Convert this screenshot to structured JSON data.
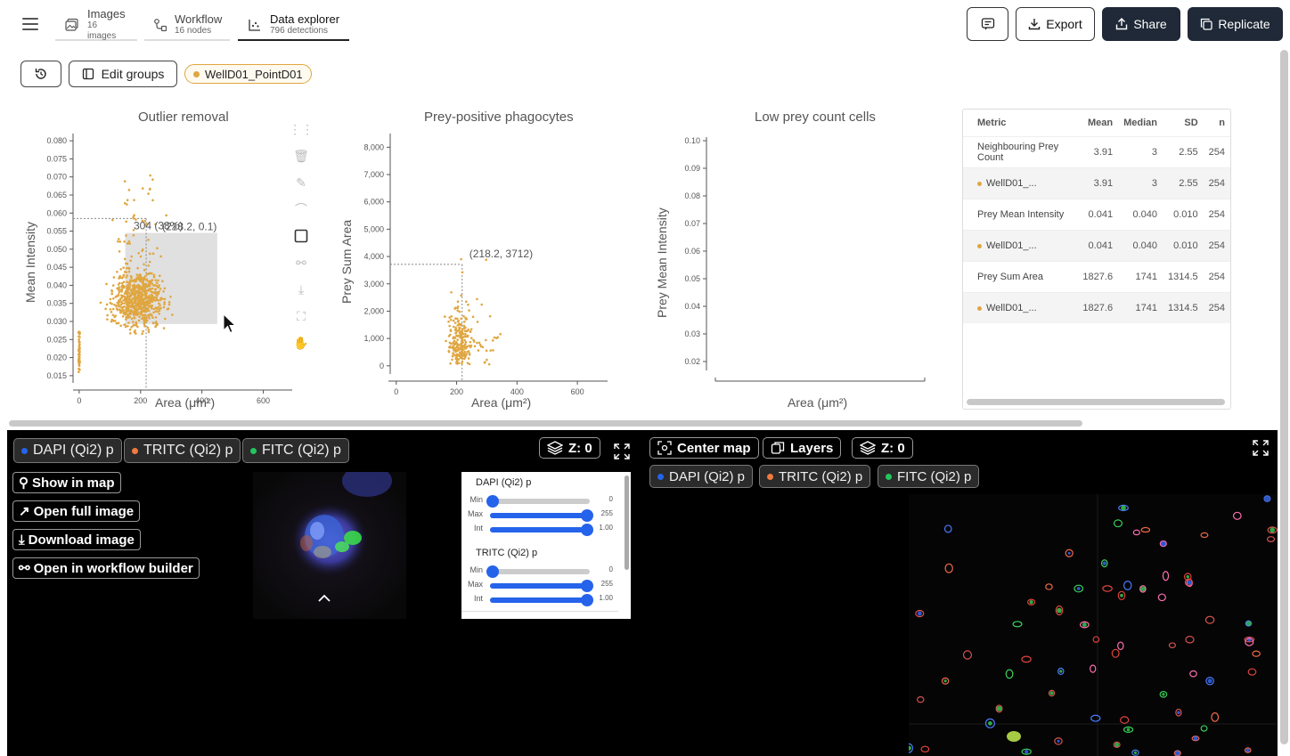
{
  "tabs": [
    {
      "label": "Images",
      "sub": "16 images",
      "icon": "images-icon"
    },
    {
      "label": "Workflow",
      "sub": "16 nodes",
      "icon": "workflow-icon"
    },
    {
      "label": "Data explorer",
      "sub": "796 detections",
      "icon": "scatter-icon"
    }
  ],
  "header": {
    "export_label": "Export",
    "share_label": "Share",
    "replicate_label": "Replicate"
  },
  "toolbar": {
    "edit_groups_label": "Edit groups",
    "well_chip_label": "WellD01_PointD01"
  },
  "colors": {
    "accent": "#1f2937",
    "point": "#e0a640",
    "dapi": "#2563eb",
    "tritc": "#f07b3f",
    "fitc": "#22c55e"
  },
  "chart_data": [
    {
      "type": "scatter",
      "title": "Outlier removal",
      "xlabel": "Area (μm²)",
      "ylabel": "Mean Intensity",
      "xlim": [
        -20,
        700
      ],
      "ylim": [
        0.013,
        0.082
      ],
      "xticks": [
        "0",
        "200",
        "400",
        "600"
      ],
      "yticks": [
        "0.015",
        "0.020",
        "0.025",
        "0.030",
        "0.035",
        "0.040",
        "0.045",
        "0.050",
        "0.055",
        "0.060",
        "0.065",
        "0.070",
        "0.075",
        "0.080"
      ],
      "series": [
        {
          "n": 796
        }
      ],
      "selection_label": "304 (38%)",
      "crosshair_label": "(218.2, 0.1)"
    },
    {
      "type": "scatter",
      "title": "Prey-positive phagocytes",
      "xlabel": "Area (μm²)",
      "ylabel": "Prey Sum Area",
      "xlim": [
        -20,
        700
      ],
      "ylim": [
        -300,
        8500
      ],
      "xticks": [
        "0",
        "200",
        "400",
        "600"
      ],
      "yticks": [
        "0",
        "1,000",
        "2,000",
        "3,000",
        "4,000",
        "5,000",
        "6,000",
        "7,000",
        "8,000"
      ],
      "series": [
        {
          "n": 254
        }
      ],
      "crosshair_label": "(218.2, 3712)"
    },
    {
      "type": "scatter",
      "title": "Low prey count cells",
      "xlabel": "Area (μm²)",
      "ylabel": "Prey Mean Intensity",
      "yticks": [
        "0.02",
        "0.03",
        "0.04",
        "0.05",
        "0.06",
        "0.07",
        "0.08",
        "0.09",
        "0.10"
      ],
      "series": []
    },
    {
      "type": "table",
      "columns": [
        "Metric",
        "Mean",
        "Median",
        "SD",
        "n"
      ],
      "rows": [
        {
          "metric": "Neighbouring Prey Count",
          "mean": "3.91",
          "median": "3",
          "sd": "2.55",
          "n": "254",
          "sub": false
        },
        {
          "metric": "WellD01_...",
          "mean": "3.91",
          "median": "3",
          "sd": "2.55",
          "n": "254",
          "sub": true
        },
        {
          "metric": "Prey Mean Intensity",
          "mean": "0.041",
          "median": "0.040",
          "sd": "0.010",
          "n": "254",
          "sub": false
        },
        {
          "metric": "WellD01_...",
          "mean": "0.041",
          "median": "0.040",
          "sd": "0.010",
          "n": "254",
          "sub": true
        },
        {
          "metric": "Prey Sum Area",
          "mean": "1827.6",
          "median": "1741",
          "sd": "1314.5",
          "n": "254",
          "sub": false
        },
        {
          "metric": "WellD01_...",
          "mean": "1827.6",
          "median": "1741",
          "sd": "1314.5",
          "n": "254",
          "sub": true
        }
      ]
    }
  ],
  "viewer": {
    "channels": [
      "DAPI (Qi2) p",
      "TRITC (Qi2) p",
      "FITC (Qi2) p"
    ],
    "z_label": "Z: 0",
    "actions": [
      "Show in map",
      "Open full image",
      "Download image",
      "Open in workflow builder"
    ],
    "sliders": [
      {
        "name": "DAPI (Qi2) p",
        "min": "0",
        "max": "255",
        "int": "1.00"
      },
      {
        "name": "TRITC (Qi2) p",
        "min": "0",
        "max": "255",
        "int": "1.00"
      }
    ],
    "slider_labels": {
      "min": "Min",
      "max": "Max",
      "int": "Int"
    }
  },
  "map": {
    "center_label": "Center map",
    "layers_label": "Layers",
    "z_label": "Z: 0",
    "channels": [
      "DAPI (Qi2) p",
      "TRITC (Qi2) p",
      "FITC (Qi2) p"
    ]
  }
}
